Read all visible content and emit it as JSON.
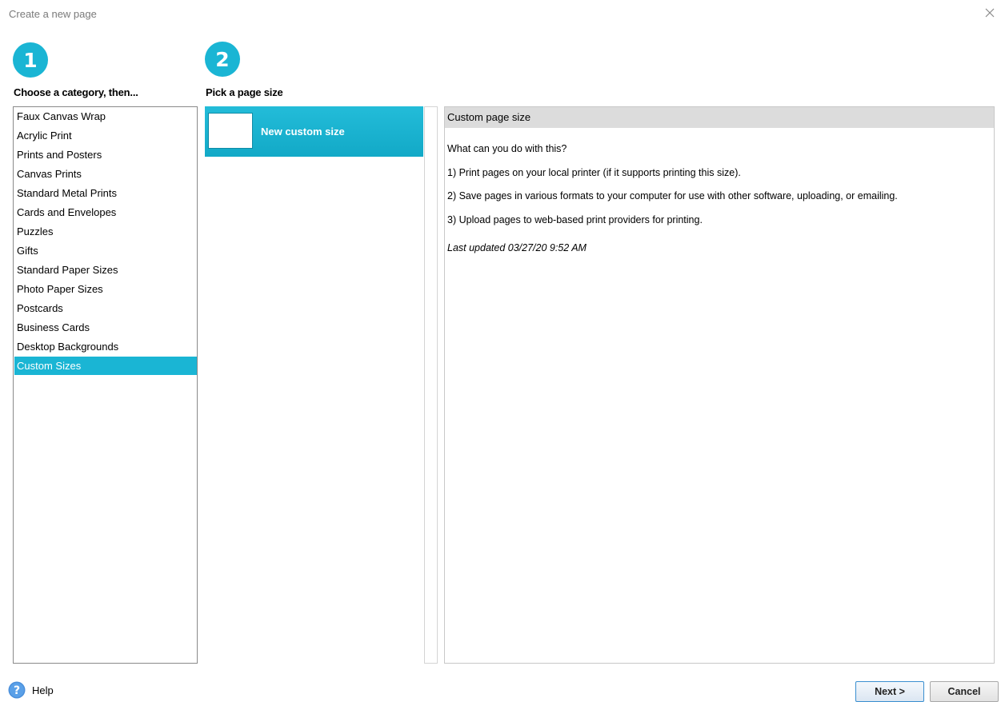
{
  "window": {
    "title": "Create a new page",
    "close_icon": "close-icon"
  },
  "step1": {
    "number": "1",
    "label": "Choose a category, then..."
  },
  "step2": {
    "number": "2",
    "label": "Pick a page size"
  },
  "categories": [
    {
      "label": "Faux Canvas Wrap",
      "selected": false
    },
    {
      "label": "Acrylic Print",
      "selected": false
    },
    {
      "label": "Prints and Posters",
      "selected": false
    },
    {
      "label": "Canvas Prints",
      "selected": false
    },
    {
      "label": "Standard Metal Prints",
      "selected": false
    },
    {
      "label": "Cards and Envelopes",
      "selected": false
    },
    {
      "label": "Puzzles",
      "selected": false
    },
    {
      "label": "Gifts",
      "selected": false
    },
    {
      "label": "Standard Paper Sizes",
      "selected": false
    },
    {
      "label": "Photo Paper Sizes",
      "selected": false
    },
    {
      "label": "Postcards",
      "selected": false
    },
    {
      "label": "Business Cards",
      "selected": false
    },
    {
      "label": "Desktop Backgrounds",
      "selected": false
    },
    {
      "label": "Custom Sizes",
      "selected": true
    }
  ],
  "page_sizes": [
    {
      "label": "New custom size",
      "selected": true
    }
  ],
  "info": {
    "header": "Custom page size",
    "question": "What can you do with this?",
    "point1": "1) Print pages on your local printer (if it supports printing this size).",
    "point2": "2) Save pages in various formats to your computer for use with other software, uploading, or emailing.",
    "point3": "3) Upload pages to web-based print providers for printing.",
    "updated": "Last updated 03/27/20 9:52 AM"
  },
  "footer": {
    "help_label": "Help",
    "help_icon": "help-icon",
    "next_label": "Next >",
    "cancel_label": "Cancel"
  },
  "colors": {
    "accent": "#1ab5d4",
    "header_gray": "#dcdcdc"
  }
}
